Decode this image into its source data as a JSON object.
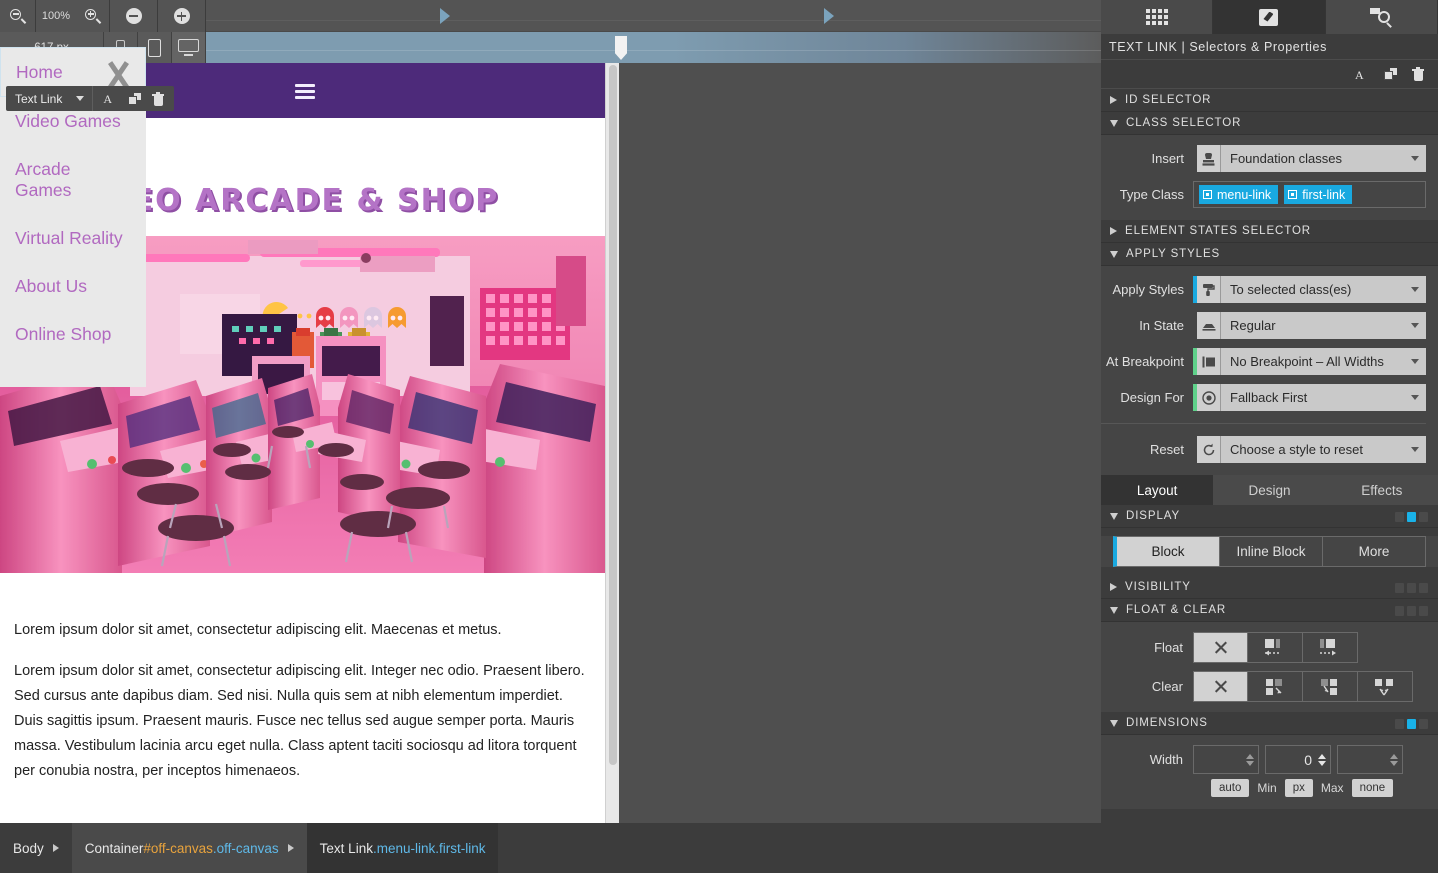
{
  "toolbar": {
    "zoom_level": "100%",
    "zoom_out_icon": "zoom-out-icon",
    "zoom_in_icon": "zoom-in-icon",
    "minus_icon": "minus-circle-icon",
    "plus_icon": "plus-circle-icon",
    "width_value": "617 px",
    "devices": [
      {
        "name": "phone",
        "label": "Phone",
        "active": false
      },
      {
        "name": "tablet",
        "label": "Tablet",
        "active": false
      },
      {
        "name": "desktop",
        "label": "Desktop",
        "active": true
      }
    ]
  },
  "context_toolbar": {
    "element_type": "Text Link",
    "icons": [
      "text-edit-icon",
      "duplicate-icon",
      "trash-icon"
    ]
  },
  "canvas": {
    "site_title": "DEO ARCADE & SHOP",
    "menu_icon": "hamburger-icon",
    "nav_items": [
      {
        "label": "Home",
        "selected": true
      },
      {
        "label": "Video Games",
        "selected": false
      },
      {
        "label": "Arcade Games",
        "selected": false
      },
      {
        "label": "Virtual Reality",
        "selected": false
      },
      {
        "label": "About Us",
        "selected": false
      },
      {
        "label": "Online Shop",
        "selected": false
      }
    ],
    "paragraphs": [
      "Lorem ipsum dolor sit amet, consectetur adipiscing elit. Maecenas et metus.",
      "Lorem ipsum dolor sit amet, consectetur adipiscing elit. Integer nec odio. Praesent libero. Sed cursus ante dapibus diam. Sed nisi. Nulla quis sem at nibh elementum imperdiet. Duis sagittis ipsum. Praesent mauris. Fusce nec tellus sed augue semper porta. Mauris massa. Vestibulum lacinia arcu eget nulla. Class aptent taciti sociosqu ad litora torquent per conubia nostra, per inceptos himenaeos."
    ]
  },
  "breadcrumb": {
    "body": "Body",
    "container": "Container",
    "container_id": "#off-canvas",
    "container_class": ".off-canvas",
    "textlink": "Text Link",
    "textlink_classes": ".menu-link.first-link"
  },
  "inspector": {
    "tabs": [
      {
        "name": "grid-tab",
        "icon": "grid-icon",
        "active": false
      },
      {
        "name": "styles-tab",
        "icon": "pen-square-icon",
        "active": true
      },
      {
        "name": "search-tab",
        "icon": "search-page-icon",
        "active": false
      }
    ],
    "title": "TEXT LINK | Selectors & Properties",
    "tool_icons": [
      "text-edit-icon",
      "duplicate-icon",
      "trash-icon"
    ],
    "sections": {
      "id_selector": "ID SELECTOR",
      "class_selector": "CLASS SELECTOR",
      "element_states_selector": "ELEMENT STATES SELECTOR",
      "apply_styles": "APPLY STYLES",
      "display": "DISPLAY",
      "visibility": "VISIBILITY",
      "float_clear": "FLOAT & CLEAR",
      "dimensions": "DIMENSIONS"
    },
    "class_selector": {
      "insert_label": "Insert",
      "insert_value": "Foundation classes",
      "type_class_label": "Type Class",
      "classes": [
        "menu-link",
        "first-link"
      ]
    },
    "apply_styles": {
      "apply_label": "Apply Styles",
      "apply_value": "To selected class(es)",
      "state_label": "In State",
      "state_value": "Regular",
      "breakpoint_label": "At Breakpoint",
      "breakpoint_value": "No Breakpoint – All Widths",
      "design_label": "Design For",
      "design_value": "Fallback First",
      "reset_label": "Reset",
      "reset_value": "Choose a style to reset"
    },
    "property_tabs": [
      {
        "label": "Layout",
        "active": true
      },
      {
        "label": "Design",
        "active": false
      },
      {
        "label": "Effects",
        "active": false
      }
    ],
    "display_options": [
      {
        "label": "Block",
        "active": true
      },
      {
        "label": "Inline Block",
        "active": false
      },
      {
        "label": "More",
        "active": false
      }
    ],
    "float": {
      "label": "Float",
      "options": [
        "none",
        "left",
        "right"
      ],
      "selected": "none"
    },
    "clear": {
      "label": "Clear",
      "options": [
        "none",
        "left",
        "right",
        "both"
      ],
      "selected": "none"
    },
    "dimensions": {
      "width_label": "Width",
      "min_value": "",
      "value": "0",
      "max_value": "",
      "auto_label": "auto",
      "min_label": "Min",
      "unit_label": "px",
      "max_label": "Max",
      "none_label": "none"
    }
  },
  "colors": {
    "accent_blue": "#19a9e0",
    "accent_green": "#5fd18a",
    "panel_bg": "#3c3c3c",
    "section_bg": "#454545",
    "header_purple": "#4d2a7a",
    "link_purple": "#b169c0",
    "breadcrumb_id": "#e8a33d",
    "breadcrumb_class": "#5fb9e8"
  }
}
